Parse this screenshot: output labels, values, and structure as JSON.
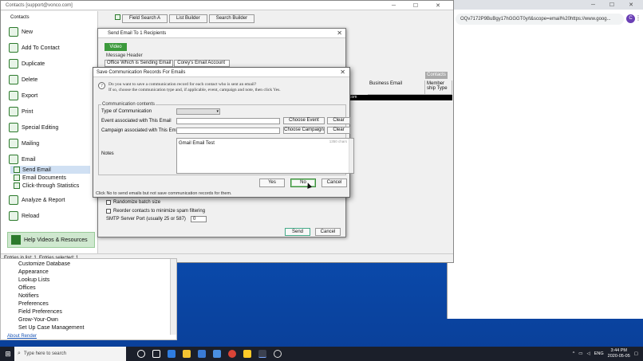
{
  "app": {
    "window_title": "Contacts   [support@vonco.com]",
    "window_controls": "─ ☐ ✕"
  },
  "browser": {
    "address": "OQv7172P9BuBgy17hGGGT0y/t&scope=email%20https://www.goog...",
    "profile_letter": "C",
    "window_controls": "─ ☐ ✕"
  },
  "sidebar": {
    "heading": "Contacts",
    "items": [
      {
        "label": "New"
      },
      {
        "label": "Add To Contact"
      },
      {
        "label": "Duplicate"
      },
      {
        "label": "Delete"
      },
      {
        "label": "Export"
      },
      {
        "label": "Print"
      },
      {
        "label": "Special Editing"
      },
      {
        "label": "Mailing"
      },
      {
        "label": "Email"
      },
      {
        "label": "Analyze & Report"
      },
      {
        "label": "Reload"
      }
    ],
    "email_sub": [
      {
        "label": "Send Email"
      },
      {
        "label": "Email Documents"
      },
      {
        "label": "Click-through Statistics"
      }
    ],
    "help_label": "Help Videos & Resources"
  },
  "toolbar": {
    "field_search": "Field Search A",
    "list_builder": "List Builder",
    "search_builder": "Search Builder"
  },
  "grid": {
    "contacts_btn": "Contacts",
    "col_business_email": "Business Email",
    "col_membership_type": "Member ship Type",
    "row_text": "com"
  },
  "status": {
    "text": "Entries in list: 1. Entries selected: 1"
  },
  "tree": {
    "items": [
      "Customize Database",
      "Appearance",
      "Lookup Lists",
      "Offices",
      "Notifiers",
      "Preferences",
      "Field Preferences",
      "Grow-Your-Own",
      "Set Up Case Management"
    ],
    "about": "About Render"
  },
  "send_dialog": {
    "title": "Send Email To 1 Recipients",
    "video_label": "Video",
    "message_header": "Message Header",
    "office_label": "Office Which is Sending Email",
    "office_value": "Corey's Email Account",
    "randomize": "Randomize batch size",
    "reorder": "Reorder contacts to minimize spam filtering",
    "smtp_label": "SMTP Server Port (usually 25 or 587)",
    "smtp_value": "0",
    "send_label": "Send",
    "cancel_label": "Cancel"
  },
  "comm_dialog": {
    "title": "Save Communication Records For Emails",
    "question_line1": "Do you want to save a communication record for each contact who is sent an email?",
    "question_line2": "If so, choose the communication type and, if applicable, event, campaign and note, then click Yes.",
    "legend": "Communication contents",
    "type_label": "Type of Communication",
    "event_label": "Event associated with This Email",
    "campaign_label": "Campaign associated with This Email",
    "notes_label": "Notes",
    "notes_value": "Gmail Email Test",
    "counter": "1350 chars",
    "choose_event": "Choose Event",
    "choose_campaign": "Choose Campaign",
    "clear": "Clear",
    "yes": "Yes",
    "no": "No",
    "cancel": "Cancel",
    "hint": "Click No to send emails but not save communication records for them."
  },
  "taskbar": {
    "search_placeholder": "Type here to search",
    "lang": "ENG",
    "time": "3:44 PM",
    "date": "2020-05-05"
  },
  "colors": {
    "accent_green": "#3c9a3c",
    "desktop_blue": "#0b4fb5",
    "taskbar": "#1b1f2a"
  }
}
